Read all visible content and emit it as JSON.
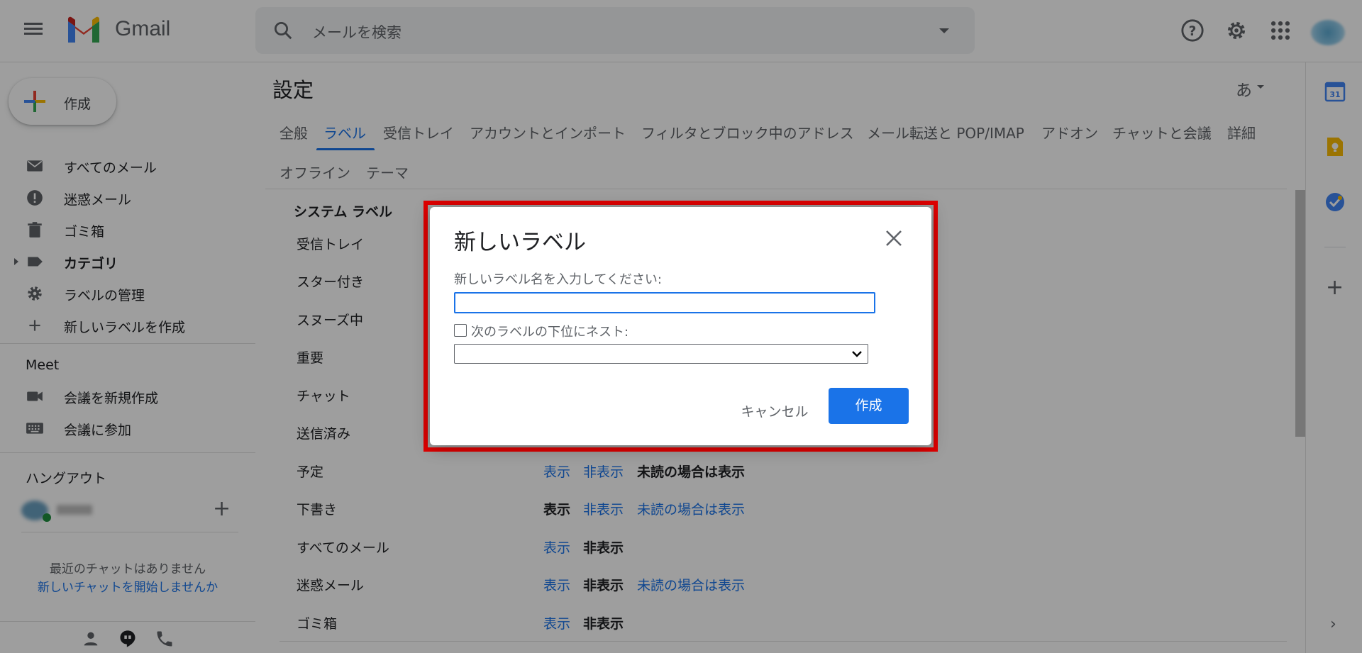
{
  "header": {
    "app_name": "Gmail",
    "search_placeholder": "メールを検索"
  },
  "sidebar": {
    "compose_label": "作成",
    "items": [
      {
        "label": "すべてのメール",
        "icon": "mail-icon"
      },
      {
        "label": "迷惑メール",
        "icon": "spam-icon"
      },
      {
        "label": "ゴミ箱",
        "icon": "trash-icon"
      },
      {
        "label": "カテゴリ",
        "icon": "label-icon",
        "bold": true
      },
      {
        "label": "ラベルの管理",
        "icon": "gear-icon"
      },
      {
        "label": "新しいラベルを作成",
        "icon": "plus-icon"
      }
    ],
    "meet": {
      "title": "Meet",
      "new_meeting": "会議を新規作成",
      "join_meeting": "会議に参加"
    },
    "hangouts": {
      "title": "ハングアウト",
      "no_chats": "最近のチャットはありません",
      "start_chat": "新しいチャットを開始しませんか"
    }
  },
  "settings": {
    "title": "設定",
    "input_tool": "あ",
    "tabs": [
      "全般",
      "ラベル",
      "受信トレイ",
      "アカウントとインポート",
      "フィルタとブロック中のアドレス",
      "メール転送と POP/IMAP",
      "アドオン",
      "チャットと会議",
      "詳細",
      "オフライン",
      "テーマ"
    ],
    "active_tab": "ラベル",
    "system_labels_header": "システム ラベル",
    "rows": [
      {
        "name": "受信トレイ"
      },
      {
        "name": "スター付き"
      },
      {
        "name": "スヌーズ中"
      },
      {
        "name": "重要"
      },
      {
        "name": "チャット"
      },
      {
        "name": "送信済み"
      },
      {
        "name": "予定",
        "show": "表示",
        "hide": "非表示",
        "unread": "未読の場合は表示"
      },
      {
        "name": "下書き",
        "show": "表示",
        "hide": "非表示",
        "unread": "未読の場合は表示"
      },
      {
        "name": "すべてのメール",
        "show": "表示",
        "hide": "非表示"
      },
      {
        "name": "迷惑メール",
        "show": "表示",
        "hide": "非表示",
        "unread": "未読の場合は表示"
      },
      {
        "name": "ゴミ箱",
        "show": "表示",
        "hide": "非表示"
      }
    ]
  },
  "dialog": {
    "title": "新しいラベル",
    "prompt": "新しいラベル名を入力してください:",
    "name_value": "",
    "nest_label": "次のラベルの下位にネスト:",
    "nest_checked": false,
    "parent_selected": "",
    "cancel_label": "キャンセル",
    "create_label": "作成"
  },
  "colors": {
    "accent": "#1a73e8",
    "highlight": "#e00000"
  }
}
